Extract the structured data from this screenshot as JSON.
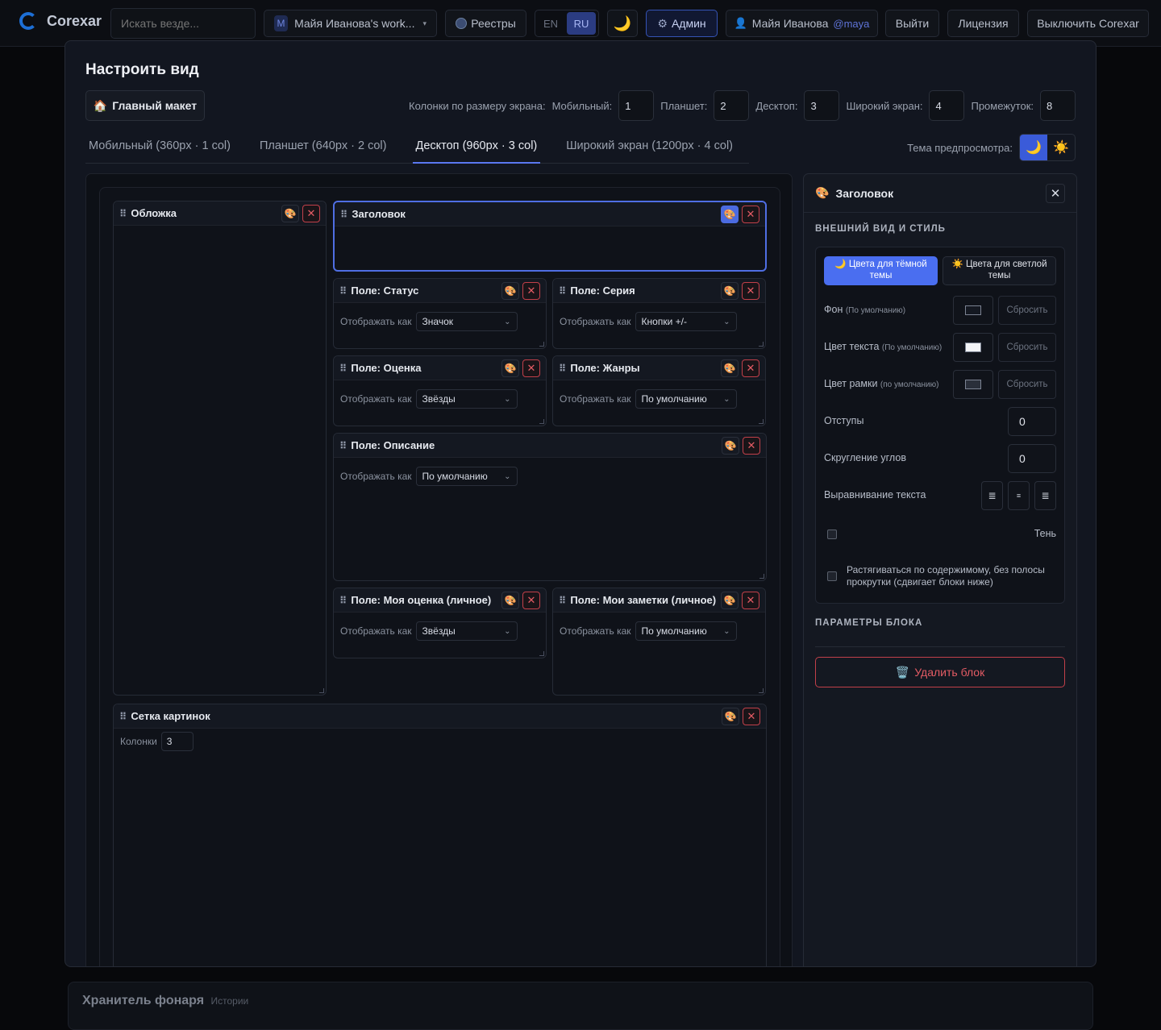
{
  "topbar": {
    "app_name": "Corexar",
    "search_placeholder": "Искать везде...",
    "workspace_badge": "M",
    "workspace_name": "Майя Иванова's work...",
    "workspace_chevron": "▾",
    "registries": "Реестры",
    "lang_en": "EN",
    "lang_ru": "RU",
    "theme_icon": "🌙",
    "admin_icon": "⚙",
    "admin": "Админ",
    "user_icon": "👤",
    "user_name": "Майя Иванова",
    "user_handle": "@maya",
    "logout": "Выйти",
    "license": "Лицензия",
    "disable": "Выключить Corexar"
  },
  "modal": {
    "title": "Настроить вид",
    "main_layout_icon": "🏠",
    "main_layout": "Главный макет",
    "cols_label": "Колонки по размеру экрана:",
    "mobile_label": "Мобильный:",
    "mobile_value": "1",
    "tablet_label": "Планшет:",
    "tablet_value": "2",
    "desktop_label": "Десктоп:",
    "desktop_value": "3",
    "wide_label": "Широкий экран:",
    "wide_value": "4",
    "gap_label": "Промежуток:",
    "gap_value": "8",
    "tabs": [
      {
        "label": "Мобильный (360px · 1 col)"
      },
      {
        "label": "Планшет (640px · 2 col)"
      },
      {
        "label": "Десктоп (960px · 3 col)"
      },
      {
        "label": "Широкий экран (1200px · 4 col)"
      }
    ],
    "active_tab": "Десктоп (960px · 3 col)",
    "preview_theme_label": "Тема предпросмотра:",
    "preview_dark_icon": "🌙",
    "preview_light_icon": "☀️"
  },
  "blocks": {
    "display_as": "Отображать как",
    "grip": "⠿",
    "style_icon": "🎨",
    "remove_icon": "✕",
    "chev": "⌄",
    "cover": "Обложка",
    "title": "Заголовок",
    "status": {
      "title": "Поле: Статус",
      "value": "Значок"
    },
    "series": {
      "title": "Поле: Серия",
      "value": "Кнопки +/-"
    },
    "rating": {
      "title": "Поле: Оценка",
      "value": "Звёзды"
    },
    "genres": {
      "title": "Поле: Жанры",
      "value": "По умолчанию"
    },
    "description": {
      "title": "Поле: Описание",
      "value": "По умолчанию"
    },
    "my_rating": {
      "title": "Поле: Моя оценка (личное)",
      "value": "Звёзды"
    },
    "my_notes": {
      "title": "Поле: Мои заметки (личное)",
      "value": "По умолчанию"
    },
    "image_grid": {
      "title": "Сетка картинок",
      "cols_label": "Колонки",
      "cols_value": "3"
    }
  },
  "panel": {
    "icon": "🎨",
    "title": "Заголовок",
    "close": "✕",
    "section_style": "ВНЕШНИЙ ВИД И СТИЛЬ",
    "dark_colors": "🌙 Цвета для тёмной темы",
    "light_colors": "☀️ Цвета для светлой темы",
    "bg_label": "Фон",
    "text_color_label": "Цвет текста",
    "border_color_label": "Цвет рамки",
    "default_hint": "(По умолчанию)",
    "default_hint_lower": "(по умолчанию)",
    "reset": "Сбросить",
    "padding_label": "Отступы",
    "padding_value": "0",
    "radius_label": "Скругление углов",
    "radius_value": "0",
    "align_label": "Выравнивание текста",
    "align_left": "≣",
    "align_center": "≡",
    "align_right": "≣",
    "shadow_label": "Тень",
    "stretch_label": "Растягиваться по содержимому, без полосы прокрутки (сдвигает блоки ниже)",
    "section_block": "ПАРАМЕТРЫ БЛОКА",
    "delete_icon": "🗑️",
    "delete": "Удалить блок"
  },
  "background": {
    "title": "Хранитель фонаря",
    "subtitle": "Истории"
  },
  "colors": {
    "accent": "#4a6ef0",
    "danger": "#e35b64",
    "bg": "#07080b"
  }
}
